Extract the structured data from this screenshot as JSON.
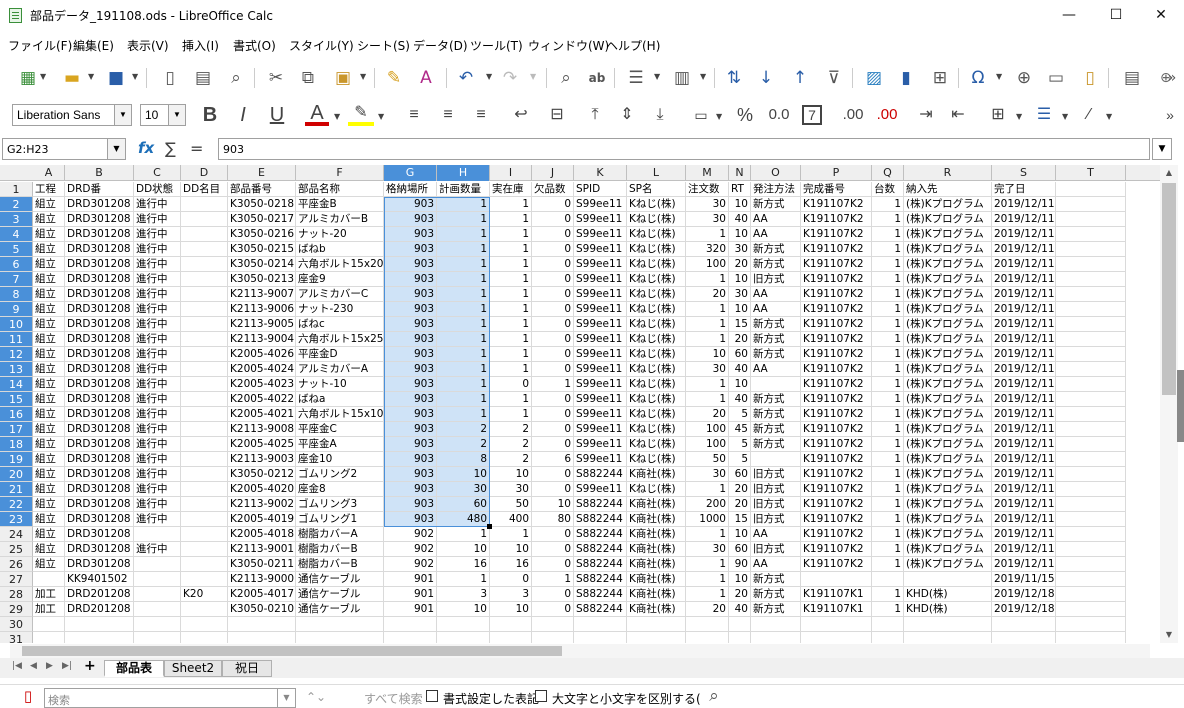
{
  "window": {
    "title": "部品データ_191108.ods - LibreOffice Calc",
    "minimize": "—",
    "maximize": "☐",
    "close": "✕"
  },
  "menu": [
    "ファイル(F)",
    "編集(E)",
    "表示(V)",
    "挿入(I)",
    "書式(O)",
    "スタイル(Y)",
    "シート(S)",
    "データ(D)",
    "ツール(T)",
    "ウィンドウ(W)",
    "ヘルプ(H)"
  ],
  "formatting": {
    "font_name": "Liberation Sans",
    "font_size": "10",
    "bold": "B",
    "italic": "I",
    "underline": "U",
    "font_color": "A",
    "percent": "%",
    "decimal": "0.0",
    "decimal_add": ".00",
    "decimal_del": ".00"
  },
  "colors": {
    "accent": "#4a90d9",
    "selection_fill": "#cfe3f7",
    "font_color_bar": "#d00000",
    "highlight_bar": "#ffff00",
    "app_green": "#3a8f3a"
  },
  "formula_bar": {
    "name_box": "G2:H23",
    "content": "903",
    "fx": "fx",
    "sum": "∑",
    "equals": "="
  },
  "columns": [
    "A",
    "B",
    "C",
    "D",
    "E",
    "F",
    "G",
    "H",
    "I",
    "J",
    "K",
    "L",
    "M",
    "N",
    "O",
    "P",
    "Q",
    "R",
    "S",
    "T"
  ],
  "selected_columns": [
    "G",
    "H"
  ],
  "rows": [
    [
      "工程",
      "DRD番",
      "DD状態",
      "DD名目",
      "部品番号",
      "部品名称",
      "格納場所",
      "計画数量",
      "実在庫",
      "欠品数",
      "SPID",
      "SP名",
      "注文数",
      "RT",
      "発注方法",
      "完成番号",
      "台数",
      "納入先",
      "完了日",
      ""
    ],
    [
      "組立",
      "DRD301208",
      "進行中",
      "",
      "K3050-0218",
      "平座金B",
      "903",
      "1",
      "1",
      "0",
      "S99ee11",
      "Kねじ(株)",
      "30",
      "10",
      "新方式",
      "K191107K2",
      "1",
      "(株)Kプログラム",
      "2019/12/11",
      ""
    ],
    [
      "組立",
      "DRD301208",
      "進行中",
      "",
      "K3050-0217",
      "アルミカバーB",
      "903",
      "1",
      "1",
      "0",
      "S99ee11",
      "Kねじ(株)",
      "30",
      "40",
      "AA",
      "K191107K2",
      "1",
      "(株)Kプログラム",
      "2019/12/11",
      ""
    ],
    [
      "組立",
      "DRD301208",
      "進行中",
      "",
      "K3050-0216",
      "ナット-20",
      "903",
      "1",
      "1",
      "0",
      "S99ee11",
      "Kねじ(株)",
      "1",
      "10",
      "AA",
      "K191107K2",
      "1",
      "(株)Kプログラム",
      "2019/12/11",
      ""
    ],
    [
      "組立",
      "DRD301208",
      "進行中",
      "",
      "K3050-0215",
      "ばねb",
      "903",
      "1",
      "1",
      "0",
      "S99ee11",
      "Kねじ(株)",
      "320",
      "30",
      "新方式",
      "K191107K2",
      "1",
      "(株)Kプログラム",
      "2019/12/11",
      ""
    ],
    [
      "組立",
      "DRD301208",
      "進行中",
      "",
      "K3050-0214",
      "六角ボルト15x20",
      "903",
      "1",
      "1",
      "0",
      "S99ee11",
      "Kねじ(株)",
      "100",
      "20",
      "新方式",
      "K191107K2",
      "1",
      "(株)Kプログラム",
      "2019/12/11",
      ""
    ],
    [
      "組立",
      "DRD301208",
      "進行中",
      "",
      "K3050-0213",
      "座金9",
      "903",
      "1",
      "1",
      "0",
      "S99ee11",
      "Kねじ(株)",
      "1",
      "10",
      "旧方式",
      "K191107K2",
      "1",
      "(株)Kプログラム",
      "2019/12/11",
      ""
    ],
    [
      "組立",
      "DRD301208",
      "進行中",
      "",
      "K2113-9007",
      "アルミカバーC",
      "903",
      "1",
      "1",
      "0",
      "S99ee11",
      "Kねじ(株)",
      "20",
      "30",
      "AA",
      "K191107K2",
      "1",
      "(株)Kプログラム",
      "2019/12/11",
      ""
    ],
    [
      "組立",
      "DRD301208",
      "進行中",
      "",
      "K2113-9006",
      "ナット-230",
      "903",
      "1",
      "1",
      "0",
      "S99ee11",
      "Kねじ(株)",
      "1",
      "10",
      "AA",
      "K191107K2",
      "1",
      "(株)Kプログラム",
      "2019/12/11",
      ""
    ],
    [
      "組立",
      "DRD301208",
      "進行中",
      "",
      "K2113-9005",
      "ばねc",
      "903",
      "1",
      "1",
      "0",
      "S99ee11",
      "Kねじ(株)",
      "1",
      "15",
      "新方式",
      "K191107K2",
      "1",
      "(株)Kプログラム",
      "2019/12/11",
      ""
    ],
    [
      "組立",
      "DRD301208",
      "進行中",
      "",
      "K2113-9004",
      "六角ボルト15x25",
      "903",
      "1",
      "1",
      "0",
      "S99ee11",
      "Kねじ(株)",
      "1",
      "20",
      "新方式",
      "K191107K2",
      "1",
      "(株)Kプログラム",
      "2019/12/11",
      ""
    ],
    [
      "組立",
      "DRD301208",
      "進行中",
      "",
      "K2005-4026",
      "平座金D",
      "903",
      "1",
      "1",
      "0",
      "S99ee11",
      "Kねじ(株)",
      "10",
      "60",
      "新方式",
      "K191107K2",
      "1",
      "(株)Kプログラム",
      "2019/12/11",
      ""
    ],
    [
      "組立",
      "DRD301208",
      "進行中",
      "",
      "K2005-4024",
      "アルミカバーA",
      "903",
      "1",
      "1",
      "0",
      "S99ee11",
      "Kねじ(株)",
      "30",
      "40",
      "AA",
      "K191107K2",
      "1",
      "(株)Kプログラム",
      "2019/12/11",
      ""
    ],
    [
      "組立",
      "DRD301208",
      "進行中",
      "",
      "K2005-4023",
      "ナット-10",
      "903",
      "1",
      "0",
      "1",
      "S99ee11",
      "Kねじ(株)",
      "1",
      "10",
      "",
      "K191107K2",
      "1",
      "(株)Kプログラム",
      "2019/12/11",
      ""
    ],
    [
      "組立",
      "DRD301208",
      "進行中",
      "",
      "K2005-4022",
      "ばねa",
      "903",
      "1",
      "1",
      "0",
      "S99ee11",
      "Kねじ(株)",
      "1",
      "40",
      "新方式",
      "K191107K2",
      "1",
      "(株)Kプログラム",
      "2019/12/11",
      ""
    ],
    [
      "組立",
      "DRD301208",
      "進行中",
      "",
      "K2005-4021",
      "六角ボルト15x10",
      "903",
      "1",
      "1",
      "0",
      "S99ee11",
      "Kねじ(株)",
      "20",
      "5",
      "新方式",
      "K191107K2",
      "1",
      "(株)Kプログラム",
      "2019/12/11",
      ""
    ],
    [
      "組立",
      "DRD301208",
      "進行中",
      "",
      "K2113-9008",
      "平座金C",
      "903",
      "2",
      "2",
      "0",
      "S99ee11",
      "Kねじ(株)",
      "100",
      "45",
      "新方式",
      "K191107K2",
      "1",
      "(株)Kプログラム",
      "2019/12/11",
      ""
    ],
    [
      "組立",
      "DRD301208",
      "進行中",
      "",
      "K2005-4025",
      "平座金A",
      "903",
      "2",
      "2",
      "0",
      "S99ee11",
      "Kねじ(株)",
      "100",
      "5",
      "新方式",
      "K191107K2",
      "1",
      "(株)Kプログラム",
      "2019/12/11",
      ""
    ],
    [
      "組立",
      "DRD301208",
      "進行中",
      "",
      "K2113-9003",
      "座金10",
      "903",
      "8",
      "2",
      "6",
      "S99ee11",
      "Kねじ(株)",
      "50",
      "5",
      "",
      "K191107K2",
      "1",
      "(株)Kプログラム",
      "2019/12/11",
      ""
    ],
    [
      "組立",
      "DRD301208",
      "進行中",
      "",
      "K3050-0212",
      "ゴムリング2",
      "903",
      "10",
      "10",
      "0",
      "S882244",
      "K商社(株)",
      "30",
      "60",
      "旧方式",
      "K191107K2",
      "1",
      "(株)Kプログラム",
      "2019/12/11",
      ""
    ],
    [
      "組立",
      "DRD301208",
      "進行中",
      "",
      "K2005-4020",
      "座金8",
      "903",
      "30",
      "30",
      "0",
      "S99ee11",
      "Kねじ(株)",
      "1",
      "20",
      "旧方式",
      "K191107K2",
      "1",
      "(株)Kプログラム",
      "2019/12/11",
      ""
    ],
    [
      "組立",
      "DRD301208",
      "進行中",
      "",
      "K2113-9002",
      "ゴムリング3",
      "903",
      "60",
      "50",
      "10",
      "S882244",
      "K商社(株)",
      "200",
      "20",
      "旧方式",
      "K191107K2",
      "1",
      "(株)Kプログラム",
      "2019/12/11",
      ""
    ],
    [
      "組立",
      "DRD301208",
      "進行中",
      "",
      "K2005-4019",
      "ゴムリング1",
      "903",
      "480",
      "400",
      "80",
      "S882244",
      "K商社(株)",
      "1000",
      "15",
      "旧方式",
      "K191107K2",
      "1",
      "(株)Kプログラム",
      "2019/12/11",
      ""
    ],
    [
      "組立",
      "DRD301208",
      "",
      "",
      "K2005-4018",
      "樹脂カバーA",
      "902",
      "1",
      "1",
      "0",
      "S882244",
      "K商社(株)",
      "1",
      "10",
      "AA",
      "K191107K2",
      "1",
      "(株)Kプログラム",
      "2019/12/11",
      ""
    ],
    [
      "組立",
      "DRD301208",
      "進行中",
      "",
      "K2113-9001",
      "樹脂カバーB",
      "902",
      "10",
      "10",
      "0",
      "S882244",
      "K商社(株)",
      "30",
      "60",
      "旧方式",
      "K191107K2",
      "1",
      "(株)Kプログラム",
      "2019/12/11",
      ""
    ],
    [
      "組立",
      "DRD301208",
      "",
      "",
      "K3050-0211",
      "樹脂カバーB",
      "902",
      "16",
      "16",
      "0",
      "S882244",
      "K商社(株)",
      "1",
      "90",
      "AA",
      "K191107K2",
      "1",
      "(株)Kプログラム",
      "2019/12/11",
      ""
    ],
    [
      "",
      "KK9401502",
      "",
      "",
      "K2113-9000",
      "通信ケーブル",
      "901",
      "1",
      "0",
      "1",
      "S882244",
      "K商社(株)",
      "1",
      "10",
      "新方式",
      "",
      "",
      "",
      "2019/11/15",
      ""
    ],
    [
      "加工",
      "DRD201208",
      "",
      "K20",
      "K2005-4017",
      "通信ケーブル",
      "901",
      "3",
      "3",
      "0",
      "S882244",
      "K商社(株)",
      "1",
      "20",
      "新方式",
      "K191107K1",
      "1",
      "KHD(株)",
      "2019/12/18",
      ""
    ],
    [
      "加工",
      "DRD201208",
      "",
      "",
      "K3050-0210",
      "通信ケーブル",
      "901",
      "10",
      "10",
      "0",
      "S882244",
      "K商社(株)",
      "20",
      "40",
      "新方式",
      "K191107K1",
      "1",
      "KHD(株)",
      "2019/12/18",
      ""
    ],
    [
      "",
      "",
      "",
      "",
      "",
      "",
      "",
      "",
      "",
      "",
      "",
      "",
      "",
      "",
      "",
      "",
      "",
      "",
      "",
      ""
    ],
    [
      "",
      "",
      "",
      "",
      "",
      "",
      "",
      "",
      "",
      "",
      "",
      "",
      "",
      "",
      "",
      "",
      "",
      "",
      "",
      ""
    ]
  ],
  "sheets": [
    "部品表",
    "Sheet2",
    "祝日"
  ],
  "active_sheet": "部品表",
  "add_sheet": "+",
  "findbar": {
    "placeholder": "検索",
    "find_all": "すべて検索",
    "opt1": "書式設定した表記",
    "opt2": "大文字と小文字を区別する("
  }
}
